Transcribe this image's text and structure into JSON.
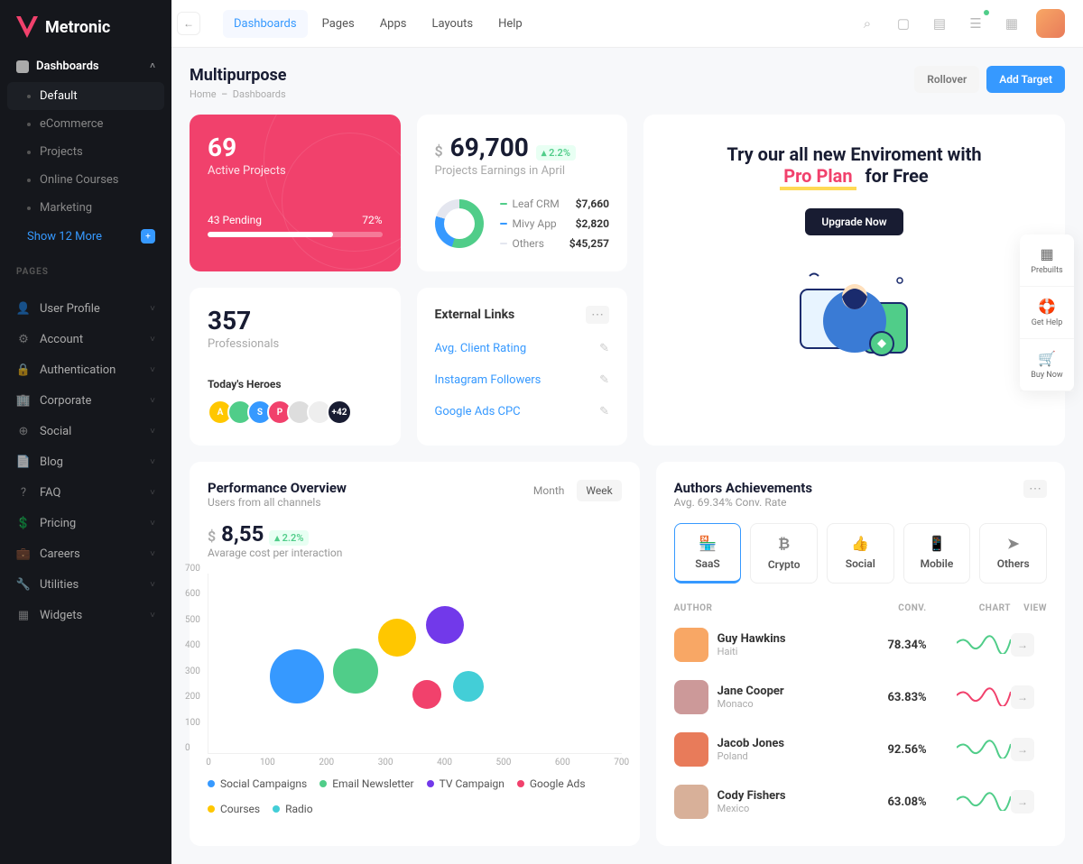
{
  "brand": "Metronic",
  "sidebar": {
    "section1_label": "Dashboards",
    "items": [
      {
        "label": "Default",
        "active": true
      },
      {
        "label": "eCommerce"
      },
      {
        "label": "Projects"
      },
      {
        "label": "Online Courses"
      },
      {
        "label": "Marketing"
      }
    ],
    "show_more": "Show 12 More",
    "pages_heading": "PAGES",
    "pages": [
      {
        "label": "User Profile",
        "icon": "👤"
      },
      {
        "label": "Account",
        "icon": "⚙"
      },
      {
        "label": "Authentication",
        "icon": "🔒"
      },
      {
        "label": "Corporate",
        "icon": "🏢"
      },
      {
        "label": "Social",
        "icon": "⊕"
      },
      {
        "label": "Blog",
        "icon": "📄"
      },
      {
        "label": "FAQ",
        "icon": "?"
      },
      {
        "label": "Pricing",
        "icon": "💲"
      },
      {
        "label": "Careers",
        "icon": "💼"
      },
      {
        "label": "Utilities",
        "icon": "🔧"
      },
      {
        "label": "Widgets",
        "icon": "▦"
      }
    ]
  },
  "topnav": [
    "Dashboards",
    "Pages",
    "Apps",
    "Layouts",
    "Help"
  ],
  "page": {
    "title": "Multipurpose",
    "crumb_home": "Home",
    "crumb_curr": "Dashboards",
    "rollover": "Rollover",
    "add_target": "Add Target"
  },
  "card_projects": {
    "value": "69",
    "label": "Active Projects",
    "pending": "43 Pending",
    "percent": "72%",
    "pct_num": 72
  },
  "card_earnings": {
    "value": "69,700",
    "delta": "2.2%",
    "label": "Projects Earnings in April",
    "legend": [
      {
        "name": "Leaf CRM",
        "val": "$7,660",
        "color": "#50cd89"
      },
      {
        "name": "Mivy App",
        "val": "$2,820",
        "color": "#3699ff"
      },
      {
        "name": "Others",
        "val": "$45,257",
        "color": "#e4e6ef"
      }
    ]
  },
  "promo": {
    "line1": "Try our all new Enviroment with",
    "highlight": "Pro Plan",
    "line2": "for Free",
    "btn": "Upgrade Now"
  },
  "card_pros": {
    "value": "357",
    "label": "Professionals",
    "heroes_label": "Today's Heroes",
    "avatars": [
      {
        "letter": "A",
        "color": "#ffc700"
      },
      {
        "letter": "",
        "color": "#50cd89"
      },
      {
        "letter": "S",
        "color": "#3699ff"
      },
      {
        "letter": "P",
        "color": "#f1416c"
      },
      {
        "letter": "",
        "color": "#ddd"
      },
      {
        "letter": "",
        "color": "#eee"
      },
      {
        "letter": "+42",
        "color": "#181c32"
      }
    ]
  },
  "card_ext": {
    "title": "External Links",
    "links": [
      "Avg. Client Rating",
      "Instagram Followers",
      "Google Ads CPC"
    ]
  },
  "perf": {
    "title": "Performance Overview",
    "sub": "Users from all channels",
    "tab_month": "Month",
    "tab_week": "Week",
    "cost": "8,55",
    "delta": "2.2%",
    "cost_label": "Avarage cost per interaction",
    "y_ticks": [
      "700",
      "600",
      "500",
      "400",
      "300",
      "200",
      "100",
      "0"
    ],
    "x_ticks": [
      "0",
      "100",
      "200",
      "300",
      "400",
      "500",
      "600",
      "700"
    ],
    "legend": [
      {
        "name": "Social Campaigns",
        "color": "#3699ff"
      },
      {
        "name": "Email Newsletter",
        "color": "#50cd89"
      },
      {
        "name": "TV Campaign",
        "color": "#7239ea"
      },
      {
        "name": "Google Ads",
        "color": "#f1416c"
      },
      {
        "name": "Courses",
        "color": "#ffc700"
      },
      {
        "name": "Radio",
        "color": "#43ced7"
      }
    ]
  },
  "authors": {
    "title": "Authors Achievements",
    "sub": "Avg. 69.34% Conv. Rate",
    "tabs": [
      {
        "label": "SaaS",
        "icon": "🏪",
        "active": true
      },
      {
        "label": "Crypto",
        "icon": "₿"
      },
      {
        "label": "Social",
        "icon": "👍"
      },
      {
        "label": "Mobile",
        "icon": "📱"
      },
      {
        "label": "Others",
        "icon": "➤"
      }
    ],
    "th_author": "AUTHOR",
    "th_conv": "CONV.",
    "th_chart": "CHART",
    "th_view": "VIEW",
    "rows": [
      {
        "name": "Guy Hawkins",
        "loc": "Haiti",
        "conv": "78.34%",
        "color": "#50cd89",
        "avcolor": "#f8a765"
      },
      {
        "name": "Jane Cooper",
        "loc": "Monaco",
        "conv": "63.83%",
        "color": "#f1416c",
        "avcolor": "#c99"
      },
      {
        "name": "Jacob Jones",
        "loc": "Poland",
        "conv": "92.56%",
        "color": "#50cd89",
        "avcolor": "#e87b5a"
      },
      {
        "name": "Cody Fishers",
        "loc": "Mexico",
        "conv": "63.08%",
        "color": "#50cd89",
        "avcolor": "#d8b099"
      }
    ]
  },
  "float": [
    {
      "label": "Prebuilts",
      "icon": "▦"
    },
    {
      "label": "Get Help",
      "icon": "🛟"
    },
    {
      "label": "Buy Now",
      "icon": "🛒"
    }
  ],
  "chart_data": {
    "type": "bubble",
    "title": "Performance Overview",
    "xlim": [
      0,
      700
    ],
    "ylim": [
      0,
      700
    ],
    "series": [
      {
        "name": "Social Campaigns",
        "color": "#3699ff",
        "x": 150,
        "y": 300,
        "size": 60
      },
      {
        "name": "Email Newsletter",
        "color": "#50cd89",
        "x": 250,
        "y": 320,
        "size": 50
      },
      {
        "name": "Courses",
        "color": "#ffc700",
        "x": 320,
        "y": 450,
        "size": 42
      },
      {
        "name": "Google Ads",
        "color": "#f1416c",
        "x": 370,
        "y": 230,
        "size": 32
      },
      {
        "name": "Radio",
        "color": "#43ced7",
        "x": 440,
        "y": 260,
        "size": 34
      },
      {
        "name": "TV Campaign",
        "color": "#7239ea",
        "x": 400,
        "y": 500,
        "size": 42
      }
    ]
  }
}
